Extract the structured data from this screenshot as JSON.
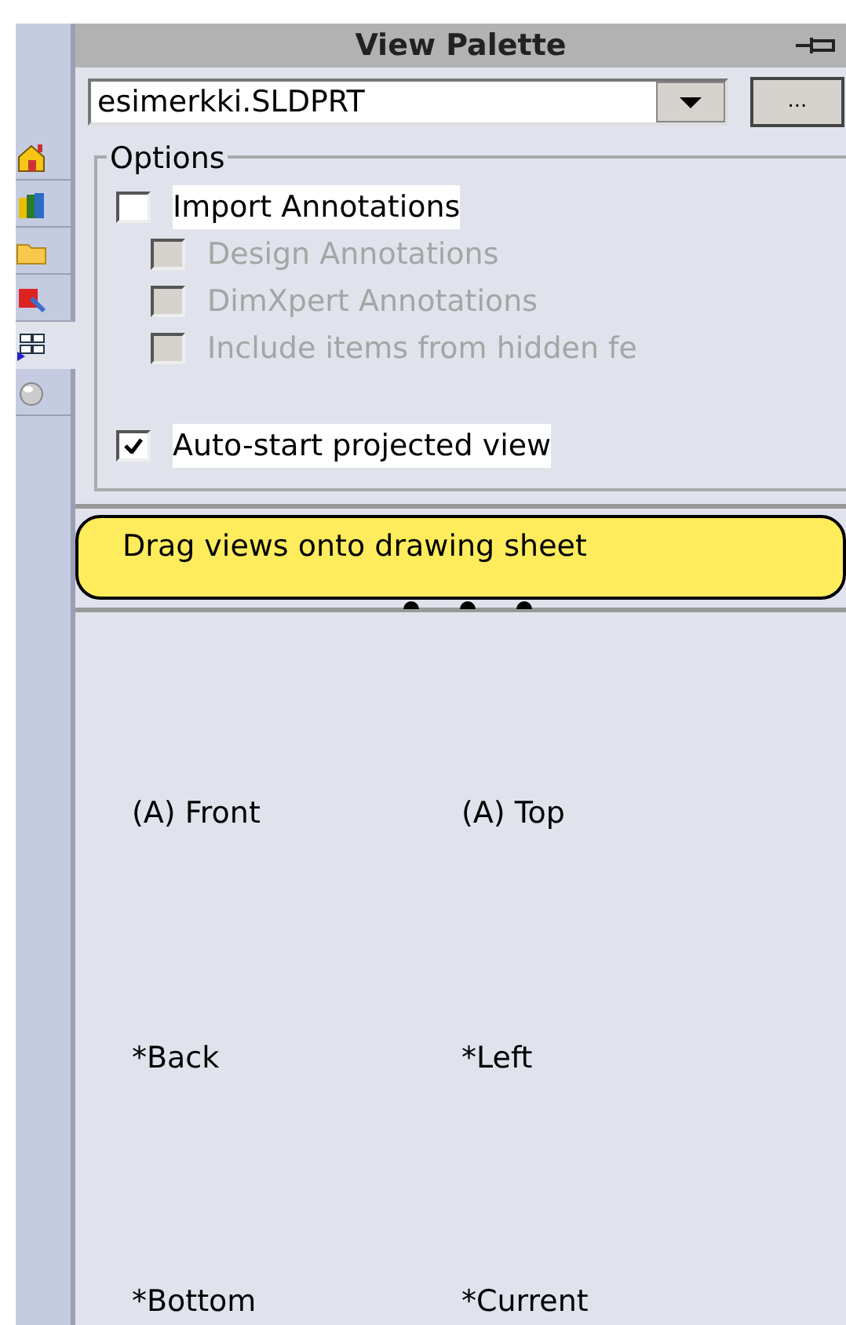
{
  "side_tabs": [
    {
      "selected": false
    },
    {
      "selected": false
    },
    {
      "selected": false
    },
    {
      "selected": false
    },
    {
      "selected": true
    },
    {
      "selected": false
    }
  ],
  "title": "View Palette",
  "file_select": {
    "value": "esimerkki.SLDPRT"
  },
  "browse_button": "...",
  "options": {
    "label": "Options",
    "items": [
      {
        "label": "Import Annotations",
        "checked": false,
        "disabled": false,
        "children": [
          {
            "label": "Design Annotations",
            "checked": false,
            "disabled": true
          },
          {
            "label": "DimXpert Annotations",
            "checked": false,
            "disabled": true
          },
          {
            "label": "Include items from hidden fe",
            "checked": false,
            "disabled": true
          }
        ]
      },
      {
        "label": "Auto-start projected view",
        "checked": true,
        "disabled": false
      }
    ]
  },
  "hint": "Drag views onto drawing sheet",
  "views": [
    "(A) Front",
    "(A) Top",
    "*Back",
    "*Left",
    "*Bottom",
    "*Current"
  ]
}
